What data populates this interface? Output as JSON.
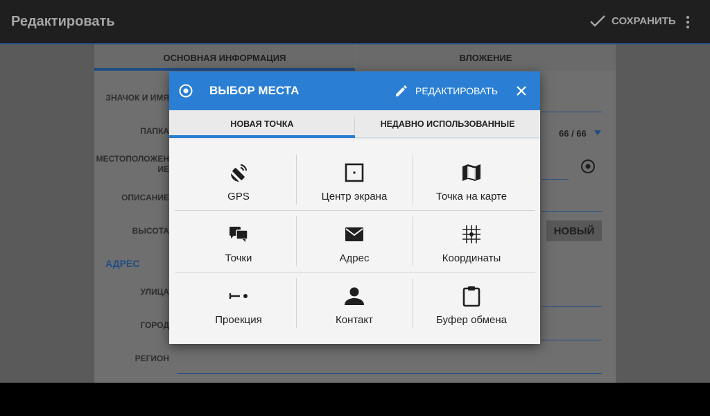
{
  "app_bar": {
    "title": "Редактировать",
    "save_label": "СОХРАНИТЬ"
  },
  "form": {
    "tabs": [
      "ОСНОВНАЯ ИНФОРМАЦИЯ",
      "ВЛОЖЕНИЕ"
    ],
    "fields": {
      "icon_name": "ЗНАЧОК И ИМЯ",
      "folder": "ПАПКА",
      "location_line1": "МЕСТОПОЛОЖЕН",
      "location_line2": "ИЕ",
      "description": "ОПИСАНИЕ",
      "altitude": "ВЫСОТА",
      "street": "УЛИЦА",
      "city": "ГОРОД",
      "region": "РЕГИОН"
    },
    "address_section": "АДРЕС",
    "folder_counter": "66 / 66",
    "new_button": "НОВЫЙ"
  },
  "dialog": {
    "title": "ВЫБОР МЕСТА",
    "edit_label": "РЕДАКТИРОВАТЬ",
    "tabs": [
      "НОВАЯ ТОЧКА",
      "НЕДАВНО ИСПОЛЬЗОВАННЫЕ"
    ],
    "options": [
      {
        "label": "GPS",
        "icon": "gps-icon"
      },
      {
        "label": "Центр экрана",
        "icon": "screen-center-icon"
      },
      {
        "label": "Точка на карте",
        "icon": "map-icon"
      },
      {
        "label": "Точки",
        "icon": "points-icon"
      },
      {
        "label": "Адрес",
        "icon": "envelope-icon"
      },
      {
        "label": "Координаты",
        "icon": "grid-icon"
      },
      {
        "label": "Проекция",
        "icon": "projection-icon"
      },
      {
        "label": "Контакт",
        "icon": "contact-icon"
      },
      {
        "label": "Буфер обмена",
        "icon": "clipboard-icon"
      }
    ]
  },
  "colors": {
    "accent": "#2a7fd4",
    "app_bar": "#1f1f1f"
  }
}
